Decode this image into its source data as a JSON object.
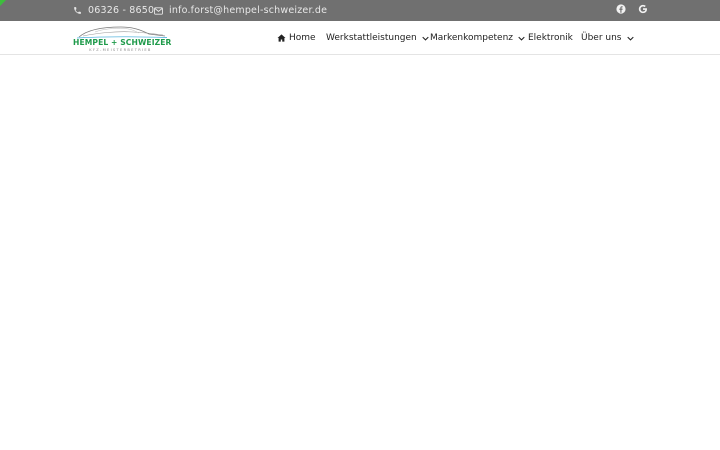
{
  "topbar": {
    "phone": "06326 - 8650",
    "email": "info.forst@hempel-schweizer.de",
    "icons": {
      "phone": "phone-icon",
      "email": "envelope-icon",
      "facebook": "facebook-icon",
      "google": "google-icon"
    }
  },
  "logo": {
    "brand": "HEMPEL + SCHWEIZER",
    "tagline": "KFZ-MEISTERBETRIEB"
  },
  "nav": {
    "items": [
      {
        "label": "Home",
        "icon": "home-icon"
      },
      {
        "label": "Werkstattleistungen",
        "dropdown": true
      },
      {
        "label": "Markenkompetenz",
        "dropdown": true
      },
      {
        "label": "Elektronik"
      },
      {
        "label": "Über uns",
        "dropdown": true
      }
    ]
  },
  "colors": {
    "topbar_bg": "#707070",
    "brand_green": "#1e9a4a",
    "nav_text": "#222222"
  }
}
